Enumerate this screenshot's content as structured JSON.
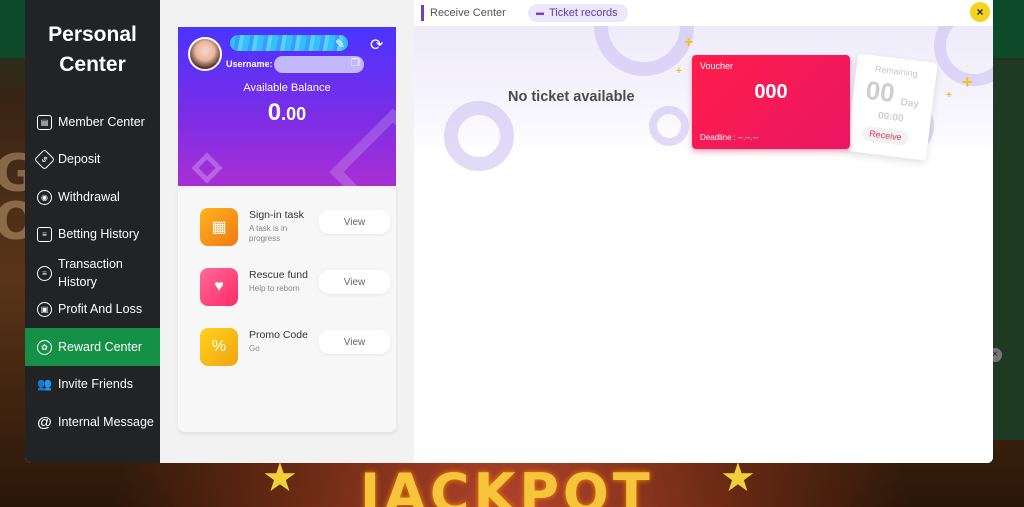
{
  "sidebar": {
    "title_line1": "Personal",
    "title_line2": "Center",
    "items": [
      {
        "label": "Member Center",
        "icon": "member-icon"
      },
      {
        "label": "Deposit",
        "icon": "deposit-icon"
      },
      {
        "label": "Withdrawal",
        "icon": "withdrawal-icon"
      },
      {
        "label": "Betting History",
        "icon": "betting-history-icon"
      },
      {
        "label_line1": "Transaction",
        "label_line2": "History",
        "icon": "transaction-history-icon"
      },
      {
        "label": "Profit And Loss",
        "icon": "profit-loss-icon"
      },
      {
        "label": "Reward Center",
        "icon": "reward-icon",
        "active": true
      },
      {
        "label": "Invite Friends",
        "icon": "invite-icon"
      },
      {
        "label": "Internal Message",
        "icon": "at-icon"
      }
    ]
  },
  "user": {
    "username_label": "Username:",
    "balance_label": "Available Balance",
    "balance_int": "0",
    "balance_dec": ".00"
  },
  "tasks": [
    {
      "title": "Sign-in task",
      "subtitle": "A task is in progress",
      "button": "View",
      "icon": "calendar-icon",
      "color": "#f7a51c"
    },
    {
      "title": "Rescue fund",
      "subtitle": "Help to reborn",
      "button": "View",
      "icon": "heart-bag-icon",
      "color": "#ff3f7a"
    },
    {
      "title": "Promo Code",
      "subtitle": "Go",
      "button": "View",
      "icon": "percent-icon",
      "color": "#f7c11c"
    }
  ],
  "tabs": {
    "receive": "Receive Center",
    "records": "Ticket records"
  },
  "content": {
    "empty_message": "No ticket available"
  },
  "voucher": {
    "label": "Voucher",
    "amount": "000",
    "deadline": "Deadline :  --.--.--",
    "remaining": "Remaining",
    "days": "00",
    "day_word": "Day",
    "time": "00:00",
    "receive_button": "Receive"
  },
  "backdrop": {
    "bigtext_line1": "GE",
    "bigtext_line2": "ON",
    "jackpot": "JACKPOT"
  },
  "colors": {
    "sidebar_bg": "#222324",
    "active_nav": "#149146",
    "voucher": "#ff1d4a",
    "close_button": "#f5d21c",
    "accent": "#6b3fd4"
  }
}
